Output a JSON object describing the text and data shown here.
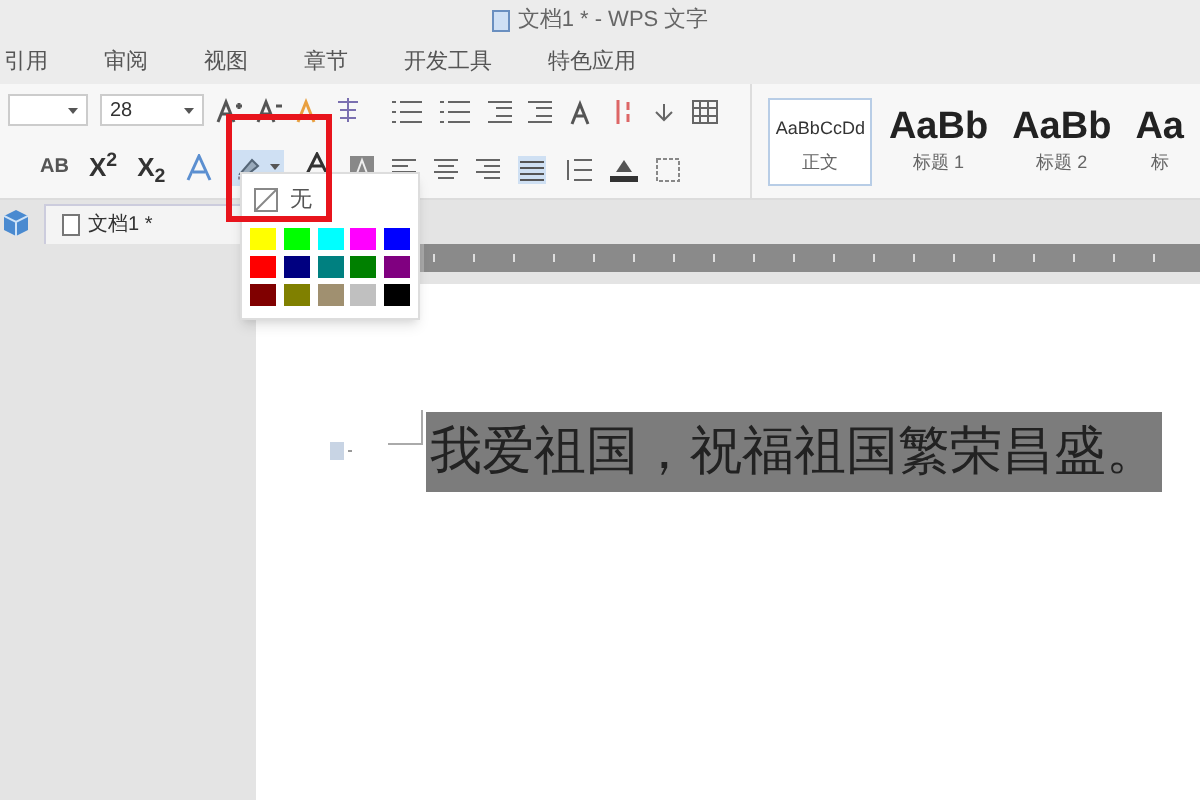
{
  "window": {
    "title": "文档1 * - WPS 文字"
  },
  "menu": [
    {
      "label": "引用"
    },
    {
      "label": "审阅"
    },
    {
      "label": "视图"
    },
    {
      "label": "章节"
    },
    {
      "label": "开发工具"
    },
    {
      "label": "特色应用"
    }
  ],
  "toolbar": {
    "font_size": "28",
    "strikethrough_label": "AB",
    "superscript": "X$^{2}$",
    "subscript": "X$_{2}$"
  },
  "styles": [
    {
      "preview": "AaBbCcDd",
      "label": "正文",
      "selected": true
    },
    {
      "preview": "AaBb",
      "label": "标题 1",
      "selected": false
    },
    {
      "preview": "AaBb",
      "label": "标题 2",
      "selected": false
    },
    {
      "preview": "Aa",
      "label": "标",
      "selected": false
    }
  ],
  "document_tab": {
    "label": "文档1 *"
  },
  "highlight_menu": {
    "none_label": "无",
    "colors": [
      {
        "color": "#ffff00"
      },
      {
        "color": "#00ff00"
      },
      {
        "color": "#00ffff"
      },
      {
        "color": "#ff00ff"
      },
      {
        "color": "#0000ff"
      },
      {
        "color": "#ff0000"
      },
      {
        "color": "#000080"
      },
      {
        "color": "#008080"
      },
      {
        "color": "#008000"
      },
      {
        "color": "#800080"
      },
      {
        "color": "#800000"
      },
      {
        "color": "#808000"
      },
      {
        "color": "#a09070"
      },
      {
        "color": "#c0c0c0"
      },
      {
        "color": "#000000"
      }
    ]
  },
  "document": {
    "paragraph": "我爱祖国，祝福祖国繁荣昌盛。",
    "selected": true
  }
}
